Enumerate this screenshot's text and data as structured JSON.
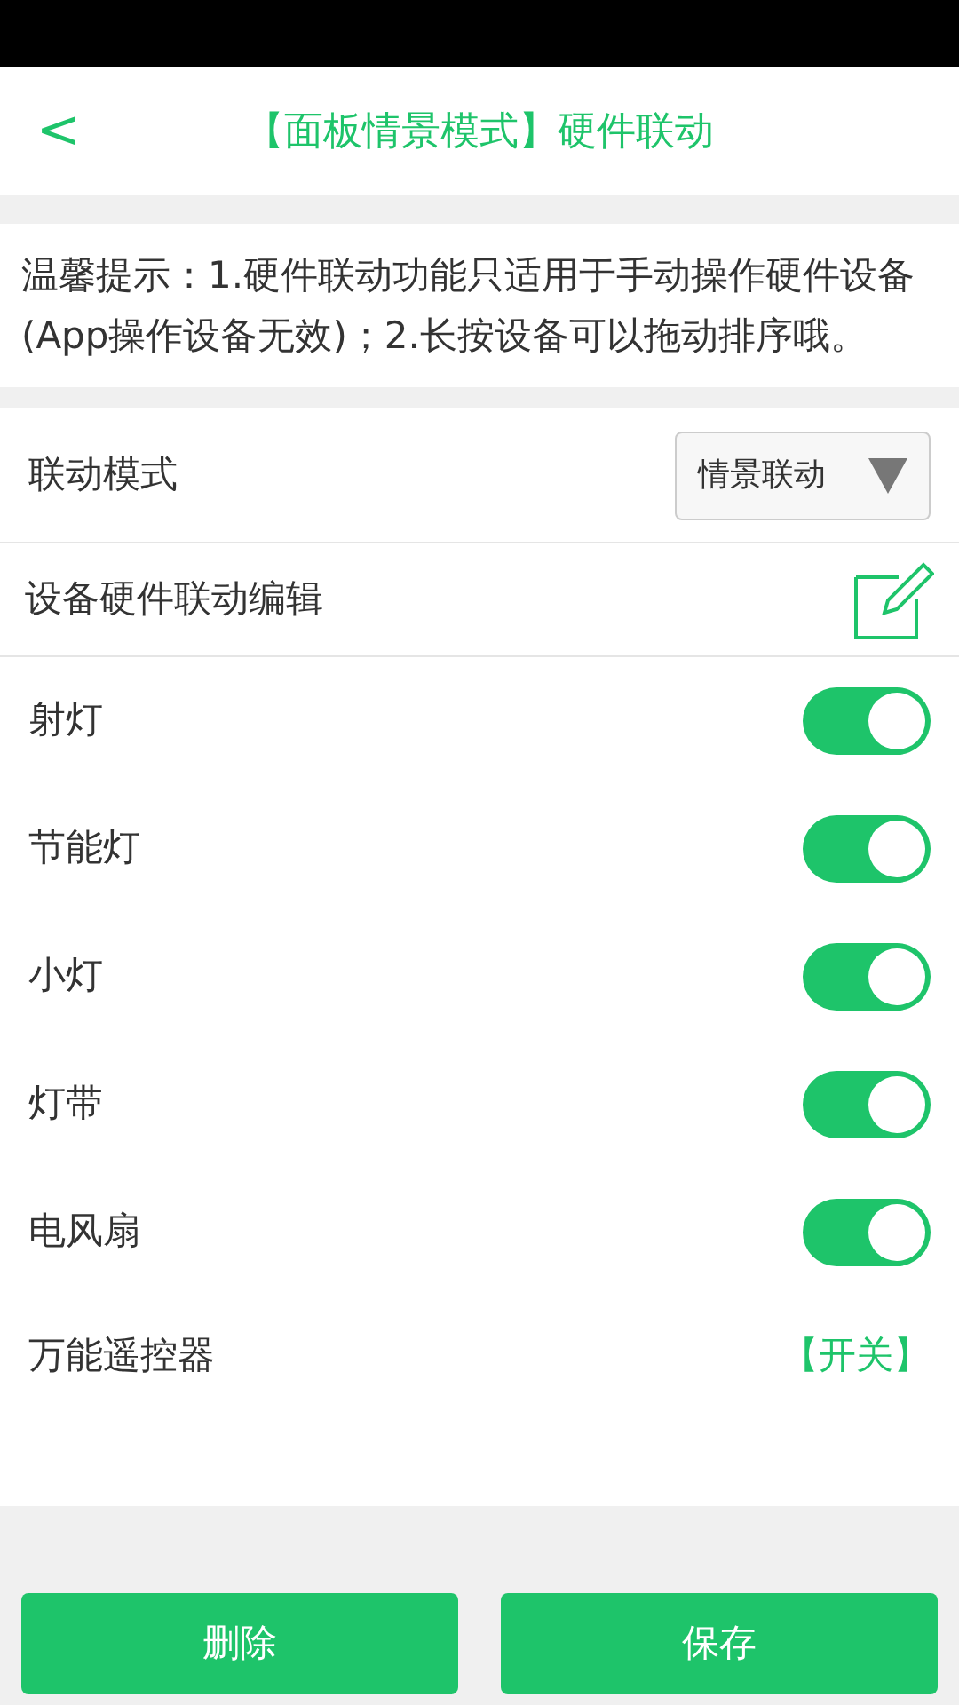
{
  "header": {
    "back": "<",
    "title": "【面板情景模式】硬件联动"
  },
  "tip": "温馨提示：1.硬件联动功能只适用于手动操作硬件设备(App操作设备无效)；2.长按设备可以拖动排序哦。",
  "mode": {
    "label": "联动模式",
    "value": "情景联动"
  },
  "edit": {
    "label": "设备硬件联动编辑"
  },
  "devices": [
    {
      "kind": "toggle",
      "name": "射灯",
      "on": true
    },
    {
      "kind": "toggle",
      "name": "节能灯",
      "on": true
    },
    {
      "kind": "toggle",
      "name": "小灯",
      "on": true
    },
    {
      "kind": "toggle",
      "name": "灯带",
      "on": true
    },
    {
      "kind": "toggle",
      "name": "电风扇",
      "on": true
    },
    {
      "kind": "action",
      "name": "万能遥控器",
      "action": "【开关】"
    }
  ],
  "buttons": [
    "删除",
    "保存"
  ]
}
